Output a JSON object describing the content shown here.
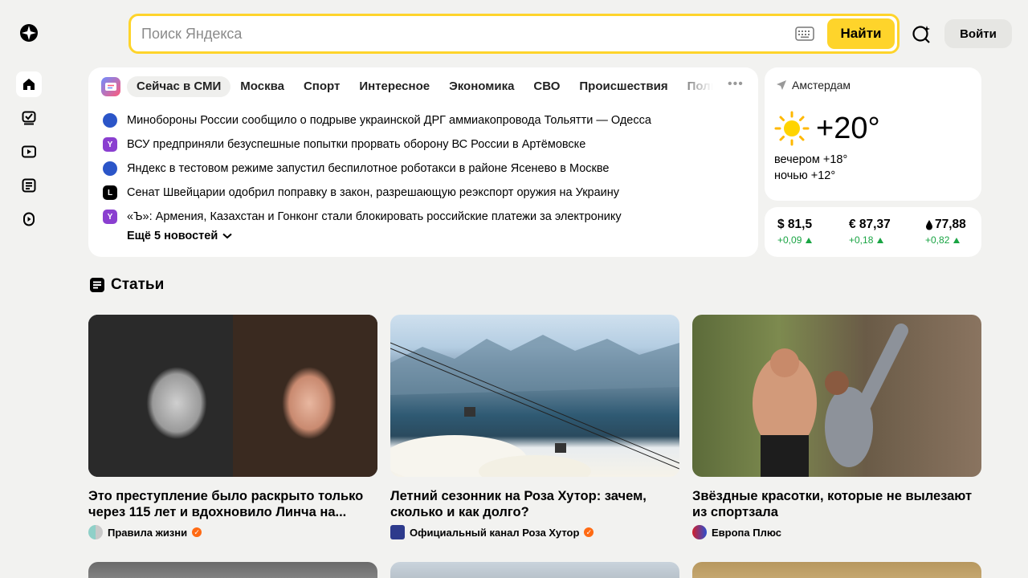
{
  "search": {
    "placeholder": "Поиск Яндекса",
    "find_label": "Найти"
  },
  "header": {
    "login_label": "Войти"
  },
  "news": {
    "tabs": [
      "Сейчас в СМИ",
      "Москва",
      "Спорт",
      "Интересное",
      "Экономика",
      "СВО",
      "Происшествия",
      "Политика"
    ],
    "items": [
      "Минобороны России сообщило о подрыве украинской ДРГ аммиакопровода Тольятти — Одесса",
      "ВСУ предприняли безуспешные попытки прорвать оборону ВС России в Артёмовске",
      "Яндекс в тестовом режиме запустил беспилотное роботакси в районе Ясенево в Москве",
      "Сенат Швейцарии одобрил поправку в закон, разрешающую реэкспорт оружия на Украину",
      "«Ъ»: Армения, Казахстан и Гонконг стали блокировать российские платежи за электронику"
    ],
    "more_label": "Ещё 5 новостей"
  },
  "weather": {
    "city": "Амстердам",
    "temp": "+20°",
    "evening": "вечером +18°",
    "night": "ночью +12°"
  },
  "rates": [
    {
      "value": "$ 81,5",
      "change": "+0,09"
    },
    {
      "value": "€ 87,37",
      "change": "+0,18"
    },
    {
      "value": "77,88",
      "change": "+0,82"
    }
  ],
  "articles": {
    "section_title": "Статьи",
    "items": [
      {
        "title": "Это преступление было раскрыто только через 115 лет и вдохновило Линча на...",
        "source": "Правила жизни"
      },
      {
        "title": "Летний сезонник на Роза Хутор: зачем, сколько и как долго?",
        "source": "Официальный канал Роза Хутор"
      },
      {
        "title": "Звёздные красотки, которые не вылезают из спортзала",
        "source": "Европа Плюс"
      }
    ]
  },
  "colors": {
    "accent": "#fed42b",
    "positive": "#19a443",
    "verified": "#ff6a13"
  }
}
